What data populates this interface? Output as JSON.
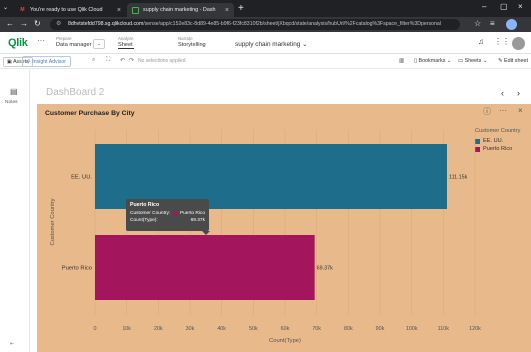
{
  "browser": {
    "tabs": [
      {
        "title": "You're ready to use Qlik Cloud",
        "active": false
      },
      {
        "title": "supply chain marketing - Dash",
        "active": true
      }
    ],
    "url_host": "8dhvtstefdd798.sg.qlikcloud.com",
    "url_path": "/sense/app/c152e83c-8d89-4e85-b9f6-f23fc8310f2b/sheet/jXbqcd/state/analysis/hubUrl/%2Fcatalog%3Fspace_filter%3Dpersonal"
  },
  "qlik": {
    "logo": "Qlik",
    "nav": [
      {
        "small": "Prepare",
        "label": "Data manager"
      },
      {
        "small": "Analyze",
        "label": "Sheet"
      },
      {
        "small": "Narrate",
        "label": "Storytelling"
      }
    ],
    "app_title": "supply chain marketing"
  },
  "toolbar": {
    "assets": "Assets",
    "insight": "Insight Advisor",
    "no_selections": "No selections applied",
    "bookmarks": "Bookmarks",
    "sheets": "Sheets",
    "edit_sheet": "Edit sheet"
  },
  "rail": {
    "notes": "Notes"
  },
  "sheet": {
    "title": "DashBoard 2"
  },
  "colors": {
    "panel_bg": "#e8b98a",
    "eeuu": "#1e6d8a",
    "puerto_rico": "#a3155c"
  },
  "chart_data": {
    "type": "bar",
    "orientation": "horizontal",
    "title": "Customer Purchase By City",
    "xlabel": "Count(Type)",
    "ylabel": "Customer Country",
    "categories": [
      "EE. UU.",
      "Puerto Rico"
    ],
    "values": [
      111150,
      69370
    ],
    "value_labels": [
      "111.15k",
      "69.37k"
    ],
    "xlim": [
      0,
      120000
    ],
    "xticks": [
      0,
      10000,
      20000,
      30000,
      40000,
      50000,
      60000,
      70000,
      80000,
      90000,
      100000,
      110000,
      120000
    ],
    "xtick_labels": [
      "0",
      "10k",
      "20k",
      "30k",
      "40k",
      "50k",
      "60k",
      "70k",
      "80k",
      "90k",
      "100k",
      "110k",
      "120k"
    ],
    "legend": {
      "title": "Customer Country",
      "entries": [
        "EE. UU.",
        "Puerto Rico"
      ],
      "placement": "right"
    },
    "tooltip": {
      "title": "Puerto Rico",
      "dim_label": "Customer Country:",
      "dim_value": "Puerto Rico",
      "measure_label": "Count(Type):",
      "measure_value": "69.37k"
    }
  }
}
